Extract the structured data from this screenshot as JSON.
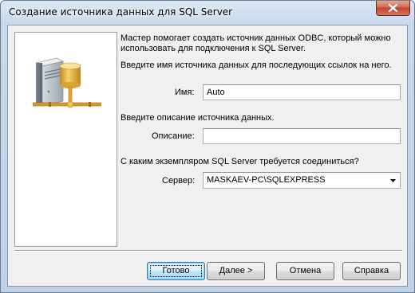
{
  "window": {
    "title": "Создание источника данных для SQL Server",
    "close_icon": "close-icon"
  },
  "intro_line1": "Мастер помогает создать источник данных ODBC, который можно",
  "intro_line2": "использовать для подключения к SQL Server.",
  "name_prompt": "Введите имя источника данных для последующих ссылок на него.",
  "name_label": "Имя:",
  "name_value": "Auto",
  "desc_prompt": "Введите описание источника данных.",
  "desc_label": "Описание:",
  "desc_value": "",
  "server_prompt": "С каким экземпляром SQL Server требуется соединиться?",
  "server_label": "Сервер:",
  "server_value": "MASKAEV-PC\\SQLEXPRESS",
  "buttons": {
    "done": "Готово",
    "next": "Далее >",
    "cancel": "Отмена",
    "help": "Справка"
  },
  "icons": {
    "wizard_art": "database-server-icon",
    "dropdown": "chevron-down-icon"
  }
}
